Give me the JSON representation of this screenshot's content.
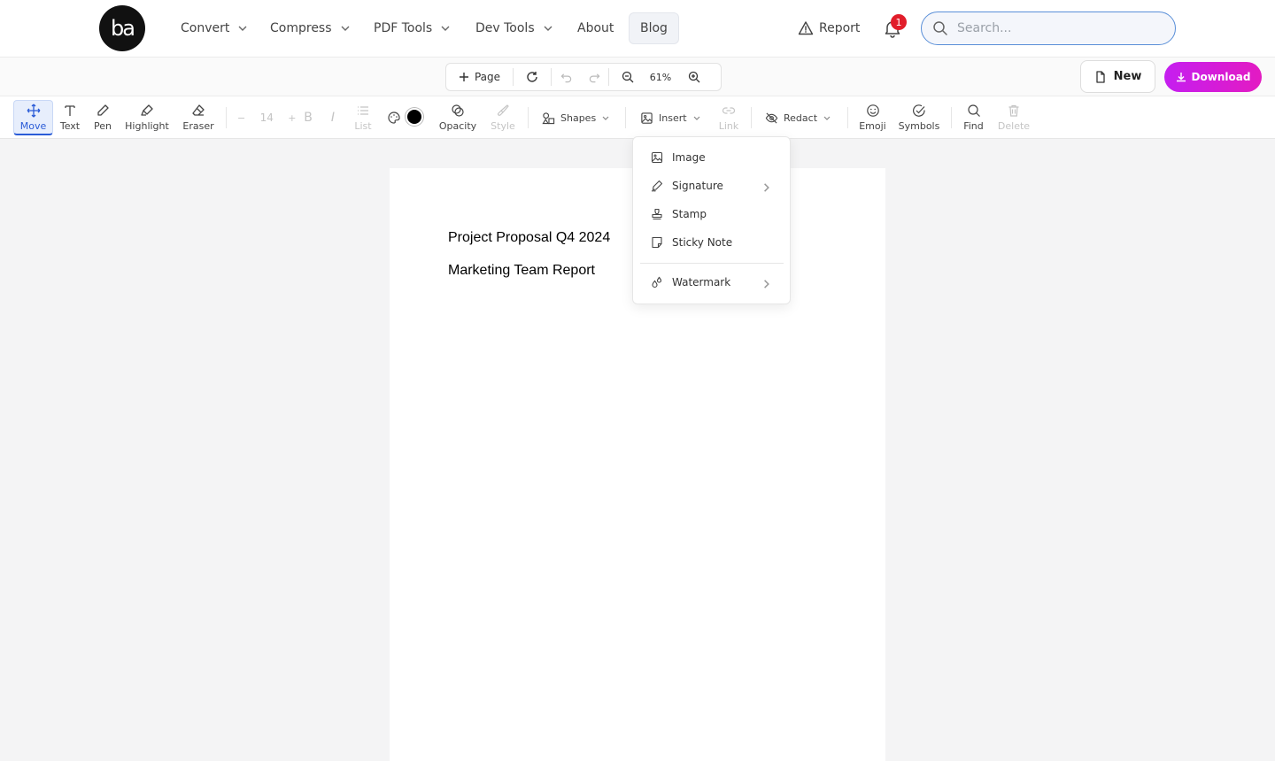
{
  "nav": {
    "logo_text": "ba",
    "items": [
      {
        "label": "Convert"
      },
      {
        "label": "Compress"
      },
      {
        "label": "PDF Tools"
      },
      {
        "label": "Dev Tools"
      },
      {
        "label": "About"
      },
      {
        "label": "Blog"
      }
    ],
    "report_label": "Report",
    "notification_count": "1",
    "search_placeholder": "Search..."
  },
  "pagebar": {
    "page_label": "Page",
    "zoom": "61%",
    "new_label": "New",
    "download_label": "Download"
  },
  "toolbar": {
    "move": "Move",
    "text": "Text",
    "pen": "Pen",
    "highlight": "Highlight",
    "eraser": "Eraser",
    "font_minus": "−",
    "font_size": "14",
    "font_plus": "+",
    "bold": "B",
    "italic": "I",
    "list": "List",
    "opacity": "Opacity",
    "style": "Style",
    "shapes": "Shapes",
    "insert": "Insert",
    "link": "Link",
    "redact": "Redact",
    "emoji": "Emoji",
    "symbols": "Symbols",
    "find": "Find",
    "delete": "Delete",
    "current_color": "#000000"
  },
  "document": {
    "line1": "Project Proposal Q4 2024",
    "line2": "Marketing Team Report"
  },
  "insert_menu": {
    "image": "Image",
    "signature": "Signature",
    "stamp": "Stamp",
    "sticky_note": "Sticky Note",
    "watermark": "Watermark"
  },
  "colors": {
    "accent": "#2a5bd7",
    "download_gradient_start": "#c51ef0",
    "download_gradient_end": "#e31bc2",
    "badge": "#e11d2a"
  }
}
